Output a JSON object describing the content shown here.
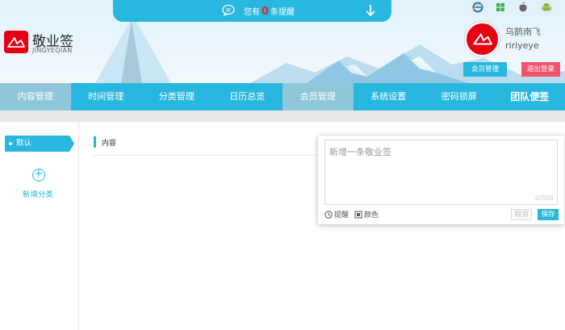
{
  "notify": {
    "prefix": "您有",
    "count": "0",
    "suffix": "条提醒"
  },
  "brand": {
    "name": "敬业签",
    "subtitle": "JINGYEQIAN"
  },
  "platform_icons": [
    "ie-icon",
    "windows-icon",
    "apple-icon",
    "android-icon"
  ],
  "user": {
    "name": "乌鹊南飞",
    "account": "ririyeye"
  },
  "header_buttons": {
    "member": "会员管理",
    "logout": "退出登录"
  },
  "nav": {
    "items": [
      {
        "label": "内容管理",
        "active": true
      },
      {
        "label": "时间管理",
        "active": false
      },
      {
        "label": "分类管理",
        "active": false
      },
      {
        "label": "日历总览",
        "active": false
      },
      {
        "label": "会员管理",
        "active": true
      },
      {
        "label": "系统设置",
        "active": false
      },
      {
        "label": "密码锁屏",
        "active": false
      },
      {
        "label": "团队便签",
        "active": false
      }
    ]
  },
  "sidebar": {
    "default_tab": "默认",
    "add_category": "新增分类"
  },
  "content": {
    "header_label": "内容"
  },
  "note_editor": {
    "placeholder": "新增一条敬业签",
    "counter": "0/500",
    "remind_label": "提醒",
    "color_label": "颜色",
    "cancel_label": "取消",
    "save_label": "保存"
  },
  "colors": {
    "accent": "#28b7de",
    "brand_red": "#e60012",
    "logout": "#f0546e",
    "nav_active": "#8fc6da"
  }
}
